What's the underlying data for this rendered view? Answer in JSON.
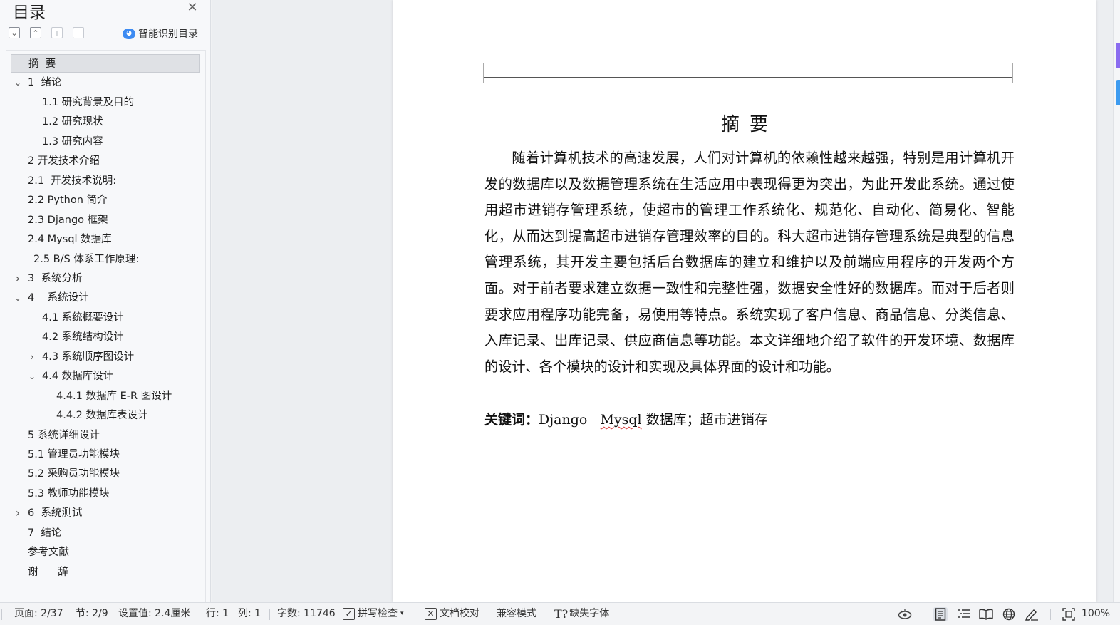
{
  "toc": {
    "title": "目录",
    "close_icon": "close-icon",
    "smart_label": "智能识别目录",
    "items": [
      {
        "label": "摘  要",
        "level": 0,
        "active": true
      },
      {
        "label": "1  绪论",
        "level": 0,
        "chevron": "down"
      },
      {
        "label": "1.1 研究背景及目的",
        "level": 1
      },
      {
        "label": "1.2 研究现状",
        "level": 1
      },
      {
        "label": "1.3 研究内容",
        "level": 1
      },
      {
        "label": "2 开发技术介绍",
        "level": 0
      },
      {
        "label": "2.1  开发技术说明:",
        "level": 0
      },
      {
        "label": "2.2 Python 简介",
        "level": 0
      },
      {
        "label": "2.3 Django 框架",
        "level": 0
      },
      {
        "label": "2.4 Mysql 数据库",
        "level": 0
      },
      {
        "label": "2.5 B/S 体系工作原理:",
        "level": 0,
        "extra_indent": true
      },
      {
        "label": "3  系统分析",
        "level": 0,
        "chevron": "right"
      },
      {
        "label": "4    系统设计",
        "level": 0,
        "chevron": "down"
      },
      {
        "label": "4.1 系统概要设计",
        "level": 1
      },
      {
        "label": "4.2 系统结构设计",
        "level": 1
      },
      {
        "label": "4.3 系统顺序图设计",
        "level": 1,
        "chevron": "right"
      },
      {
        "label": "4.4 数据库设计",
        "level": 1,
        "chevron": "down"
      },
      {
        "label": "4.4.1 数据库 E-R 图设计",
        "level": 2
      },
      {
        "label": "4.4.2 数据库表设计",
        "level": 2
      },
      {
        "label": "5 系统详细设计",
        "level": 0
      },
      {
        "label": "5.1 管理员功能模块",
        "level": 0
      },
      {
        "label": "5.2 采购员功能模块",
        "level": 0
      },
      {
        "label": "5.3 教师功能模块",
        "level": 0
      },
      {
        "label": "6  系统测试",
        "level": 0,
        "chevron": "right"
      },
      {
        "label": "7  结论",
        "level": 0
      },
      {
        "label": "参考文献",
        "level": 0
      },
      {
        "label": "谢      辞",
        "level": 0
      }
    ]
  },
  "document": {
    "heading": "摘要",
    "body": "随着计算机技术的高速发展，人们对计算机的依赖性越来越强，特别是用计算机开发的数据库以及数据管理系统在生活应用中表现得更为突出，为此开发此系统。通过使用超市进销存管理系统，使超市的管理工作系统化、规范化、自动化、简易化、智能化，从而达到提高超市进销存管理效率的目的。科大超市进销存管理系统是典型的信息管理系统，其开发主要包括后台数据库的建立和维护以及前端应用程序的开发两个方面。对于前者要求建立数据一致性和完整性强，数据安全性好的数据库。而对于后者则要求应用程序功能完备，易使用等特点。系统实现了客户信息、商品信息、分类信息、入库记录、出库记录、供应商信息等功能。本文详细地介绍了软件的开发环境、数据库的设计、各个模块的设计和实现及具体界面的设计和功能。",
    "keywords_label": "关键词：",
    "keywords_1": "Django   ",
    "keywords_2": "Mysql",
    "keywords_3": " 数据库；超市进销存"
  },
  "status_bar": {
    "page": "页面: 2/37",
    "section": "节: 2/9",
    "setting": "设置值: 2.4厘米",
    "row": "行: 1",
    "col": "列: 1",
    "word_count": "字数: 11746",
    "spell_check": "拼写检查",
    "proofread": "文档校对",
    "compat_mode": "兼容模式",
    "missing_font": "缺失字体",
    "zoom": "100%"
  },
  "colors": {
    "accent": "#3d8bf2",
    "edge_purple": "#8a6cf0",
    "edge_blue": "#3d9bf0"
  }
}
